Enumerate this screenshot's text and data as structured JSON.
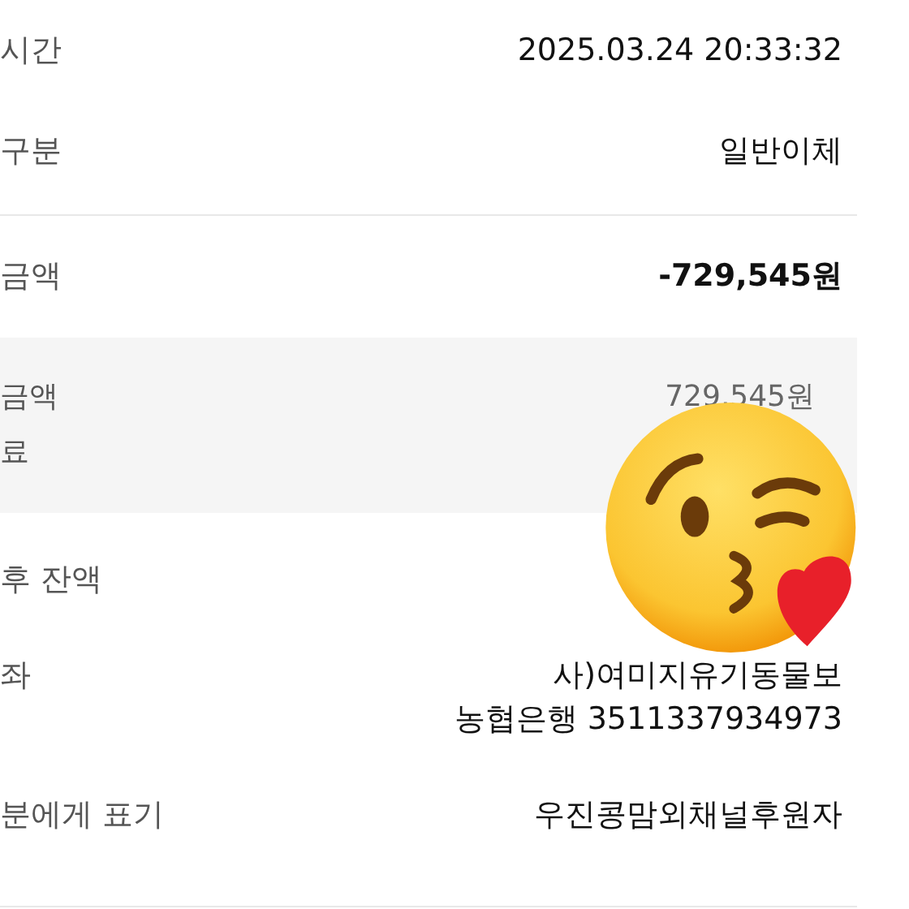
{
  "rows": [
    {
      "label": "시간",
      "value": "2025.03.24 20:33:32"
    },
    {
      "label": "구분",
      "value": "일반이체"
    }
  ],
  "amount": {
    "label": "금액",
    "value": "-729,545원"
  },
  "breakdown": [
    {
      "label": "금액",
      "value": "729,545원"
    },
    {
      "label": "료"
    }
  ],
  "details": [
    {
      "label": "후 잔액"
    },
    {
      "label": "좌",
      "values": [
        "사)여미지유기동물보",
        "농협은행 3511337934973"
      ]
    },
    {
      "label": "분에게 표기",
      "values": [
        "우진콩맘외채널후원자"
      ]
    }
  ]
}
